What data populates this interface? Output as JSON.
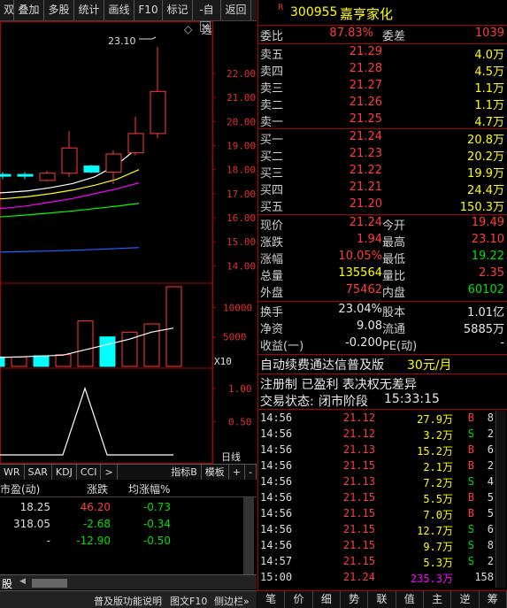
{
  "toolbar": {
    "buttons": [
      {
        "label": "双",
        "name": "tb-double"
      },
      {
        "label": "叠加",
        "name": "tb-overlay"
      },
      {
        "label": "多股",
        "name": "tb-multi"
      },
      {
        "label": "统计",
        "name": "tb-stats"
      },
      {
        "label": "画线",
        "name": "tb-draw"
      },
      {
        "label": "F10",
        "name": "tb-f10"
      },
      {
        "label": "标记",
        "name": "tb-mark"
      },
      {
        "label": "-自选",
        "name": "tb-watchlist"
      },
      {
        "label": "返回",
        "name": "tb-back"
      }
    ]
  },
  "chart_data": [
    {
      "type": "candlestick",
      "title": "",
      "peak_label": "23.10",
      "ylim": [
        13.5,
        23.8
      ],
      "yticks": [
        "22.00",
        "21.00",
        "20.00",
        "19.00",
        "18.00",
        "17.00",
        "16.00",
        "15.00",
        "14.00"
      ],
      "candles": [
        {
          "open": 17.8,
          "close": 17.75,
          "high": 17.9,
          "low": 17.6
        },
        {
          "open": 17.8,
          "close": 17.75,
          "high": 17.9,
          "low": 17.6
        },
        {
          "open": 17.55,
          "close": 17.85,
          "high": 17.95,
          "low": 17.5
        },
        {
          "open": 17.85,
          "close": 18.9,
          "high": 19.6,
          "low": 17.7
        },
        {
          "open": 18.15,
          "close": 17.9,
          "high": 18.2,
          "low": 17.85
        },
        {
          "open": 17.9,
          "close": 18.65,
          "high": 18.8,
          "low": 17.4
        },
        {
          "open": 18.7,
          "close": 19.5,
          "high": 20.2,
          "low": 18.6
        },
        {
          "open": 19.5,
          "close": 21.25,
          "high": 23.1,
          "low": 19.3
        }
      ],
      "ma_lines": [
        {
          "color": "#ffffff",
          "values": [
            17.0,
            17.05,
            17.12,
            17.25,
            17.42,
            17.7,
            18.2,
            18.95
          ]
        },
        {
          "color": "#ffff00",
          "values": [
            16.75,
            16.8,
            16.88,
            17.0,
            17.15,
            17.35,
            17.6,
            18.0
          ]
        },
        {
          "color": "#ff00ff",
          "values": [
            16.35,
            16.4,
            16.5,
            16.65,
            16.8,
            17.0,
            17.2,
            17.45
          ]
        },
        {
          "color": "#00ff00",
          "values": [
            16.0,
            16.05,
            16.12,
            16.2,
            16.28,
            16.38,
            16.48,
            16.6
          ]
        },
        {
          "color": "#2060ff",
          "values": [
            14.55,
            14.58,
            14.6,
            14.62,
            14.65,
            14.68,
            14.72,
            14.76
          ]
        }
      ]
    },
    {
      "type": "bar",
      "title": "",
      "ylim": [
        0,
        13500
      ],
      "yticks": [
        "10000",
        "5000"
      ],
      "unit_label": "X10",
      "values": [
        1600,
        1600,
        1800,
        2000,
        7700,
        5000,
        5800,
        7200,
        13500
      ],
      "colors": [
        "#00ffff",
        "#ff3c3c",
        "#00ffff",
        "#ff3c3c",
        "#ff3c3c",
        "#00ffff",
        "#ff3c3c",
        "#ff3c3c",
        "#ff3c3c"
      ],
      "ma_values": [
        1500,
        1600,
        1750,
        1900,
        2800,
        3700,
        4600,
        5800,
        6500
      ]
    },
    {
      "type": "line",
      "title": "",
      "ylim": [
        0,
        1.25
      ],
      "yticks": [
        "1.00",
        "0.50"
      ],
      "values": [
        0,
        0,
        0,
        0,
        1.0,
        0,
        0,
        0,
        0
      ]
    }
  ],
  "indicator_tabs": {
    "tabs": [
      "WR",
      "SAR",
      "KDJ",
      "CCI",
      ">"
    ],
    "right_tabs": [
      "指标B",
      "模板",
      "+",
      "-"
    ],
    "daily_label": "日线"
  },
  "bottom_table": {
    "headers": [
      "市盈(动)",
      "涨跌",
      "均涨幅%"
    ],
    "rows": [
      {
        "pe": "18.25",
        "chg": "46.20",
        "avg": "-0.73"
      },
      {
        "pe": "318.05",
        "chg": "-2.68",
        "avg": "-0.34"
      },
      {
        "pe": "-",
        "chg": "-12.90",
        "avg": "-0.50"
      }
    ],
    "bottom_tab": "股"
  },
  "statusbar": {
    "text1": "普及版功能说明",
    "text2": "图文F10",
    "text3": "侧边栏»"
  },
  "quote": {
    "code": "300955",
    "name": "嘉亨家化",
    "weibi_label": "委比",
    "weibi": "87.83%",
    "weicha_label": "委差",
    "weicha": "1039",
    "asks": [
      {
        "label": "卖五",
        "price": "21.29",
        "vol": "4.0万"
      },
      {
        "label": "卖四",
        "price": "21.28",
        "vol": "4.5万"
      },
      {
        "label": "卖三",
        "price": "21.27",
        "vol": "1.1万"
      },
      {
        "label": "卖二",
        "price": "21.26",
        "vol": "1.1万"
      },
      {
        "label": "卖一",
        "price": "21.25",
        "vol": "4.7万"
      }
    ],
    "bids": [
      {
        "label": "买一",
        "price": "21.24",
        "vol": "20.8万"
      },
      {
        "label": "买二",
        "price": "21.23",
        "vol": "20.2万"
      },
      {
        "label": "买三",
        "price": "21.22",
        "vol": "19.9万"
      },
      {
        "label": "买四",
        "price": "21.21",
        "vol": "24.4万"
      },
      {
        "label": "买五",
        "price": "21.20",
        "vol": "150.3万"
      }
    ],
    "stats": [
      {
        "l1": "现价",
        "v1": "21.24",
        "c1": "red",
        "l2": "今开",
        "v2": "19.49",
        "c2": "red"
      },
      {
        "l1": "涨跌",
        "v1": "1.94",
        "c1": "red",
        "l2": "最高",
        "v2": "23.10",
        "c2": "red"
      },
      {
        "l1": "涨幅",
        "v1": "10.05%",
        "c1": "red",
        "l2": "最低",
        "v2": "19.22",
        "c2": "grn"
      },
      {
        "l1": "总量",
        "v1": "135564",
        "c1": "yel",
        "l2": "量比",
        "v2": "2.35",
        "c2": "red"
      },
      {
        "l1": "外盘",
        "v1": "75462",
        "c1": "red",
        "l2": "内盘",
        "v2": "60102",
        "c2": "grn"
      }
    ],
    "fin": [
      {
        "l1": "换手",
        "v1": "23.04%",
        "l2": "股本",
        "v2": "1.01亿"
      },
      {
        "l1": "净资",
        "v1": "9.08",
        "l2": "流通",
        "v2": "5885万"
      },
      {
        "l1": "收益(一)",
        "v1": "-0.200",
        "l2": "PE(动)",
        "v2": "-"
      }
    ],
    "promo_text": "自动续费通达信普及版",
    "promo_price": "30元/月",
    "info_line": "注册制 已盈利 表决权无差异",
    "trade_status_label": "交易状态:",
    "trade_status": "闭市阶段",
    "trade_time": "15:33:15"
  },
  "ticks": [
    {
      "t": "14:56",
      "p": "21.12",
      "v": "27.9万",
      "bs": "B",
      "n": "8"
    },
    {
      "t": "14:56",
      "p": "21.12",
      "v": "3.2万",
      "bs": "S",
      "n": "2"
    },
    {
      "t": "14:56",
      "p": "21.13",
      "v": "15.2万",
      "bs": "B",
      "n": "6"
    },
    {
      "t": "14:56",
      "p": "21.15",
      "v": "2.1万",
      "bs": "B",
      "n": "2"
    },
    {
      "t": "14:56",
      "p": "21.13",
      "v": "7.2万",
      "bs": "S",
      "n": "4"
    },
    {
      "t": "14:56",
      "p": "21.15",
      "v": "5.5万",
      "bs": "B",
      "n": "5"
    },
    {
      "t": "14:56",
      "p": "21.15",
      "v": "7.0万",
      "bs": "B",
      "n": "5"
    },
    {
      "t": "14:56",
      "p": "21.15",
      "v": "12.7万",
      "bs": "S",
      "n": "6"
    },
    {
      "t": "14:56",
      "p": "21.15",
      "v": "9.7万",
      "bs": "S",
      "n": "8"
    },
    {
      "t": "14:57",
      "p": "21.15",
      "v": "5.3万",
      "bs": "S",
      "n": "2"
    },
    {
      "t": "15:00",
      "p": "21.24",
      "v": "235.3万",
      "bs": "",
      "n": "158"
    }
  ],
  "rbar": [
    "笔",
    "价",
    "细",
    "势",
    "联",
    "值",
    "主",
    "逆",
    "筹"
  ]
}
